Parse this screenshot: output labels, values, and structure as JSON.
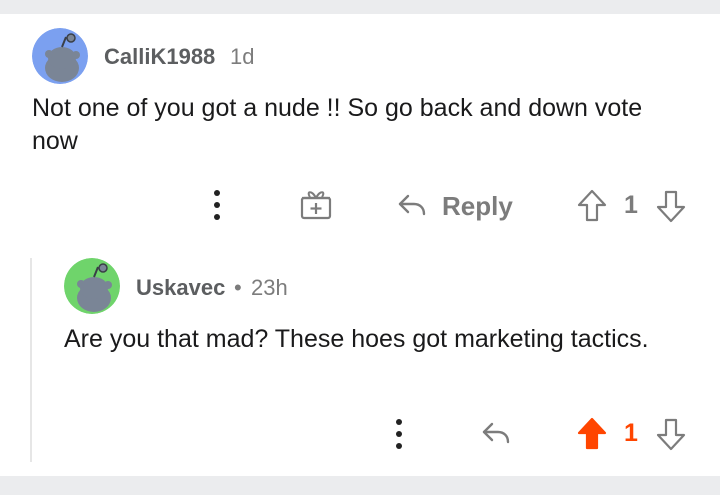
{
  "colors": {
    "upvote_active": "#ff4500",
    "text_muted": "#7c7c7c",
    "avatar1_bg": "#7ba0f0",
    "avatar2_bg": "#6fd46b"
  },
  "comment": {
    "username": "CalliK1988",
    "age": "1d",
    "text": "Not one of you got a nude !! So go back and down vote now",
    "reply_label": "Reply",
    "score": "1",
    "avatar_icon": "snoo-avatar-icon"
  },
  "reply": {
    "username": "Uskavec",
    "separator": "•",
    "age": "23h",
    "text": "Are you that mad? These hoes got marketing tactics.",
    "score": "1",
    "avatar_icon": "snoo-avatar-icon"
  }
}
